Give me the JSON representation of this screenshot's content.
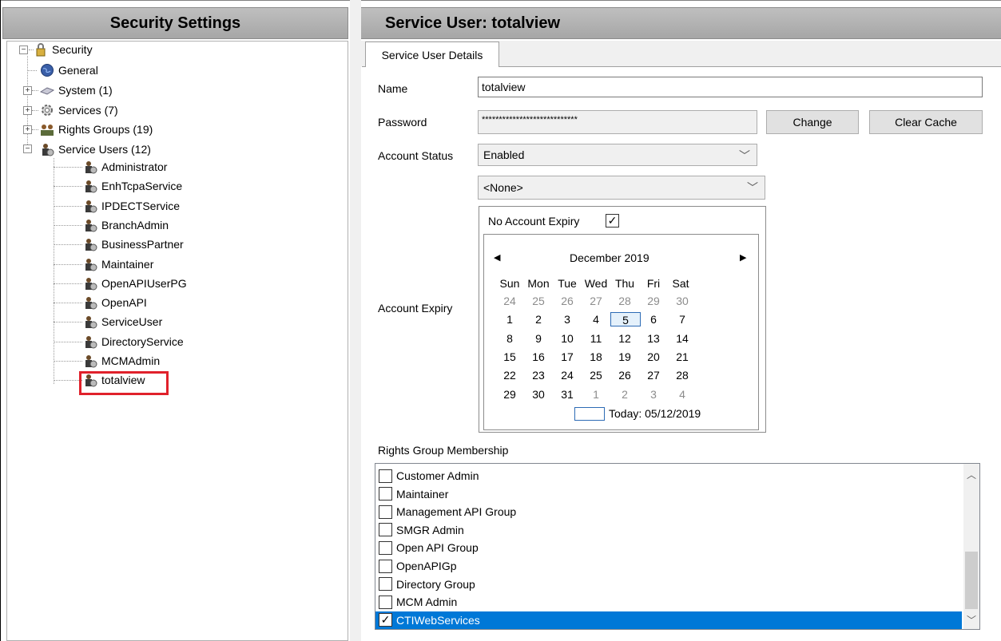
{
  "left": {
    "title": "Security Settings",
    "tree": {
      "root": "Security",
      "general": "General",
      "system": "System (1)",
      "services": "Services (7)",
      "rights_groups": "Rights Groups (19)",
      "service_users": "Service Users (12)",
      "users": [
        "Administrator",
        "EnhTcpaService",
        "IPDECTService",
        "BranchAdmin",
        "BusinessPartner",
        "Maintainer",
        "OpenAPIUserPG",
        "OpenAPI",
        "ServiceUser",
        "DirectoryService",
        "MCMAdmin",
        "totalview"
      ]
    }
  },
  "right": {
    "title": "Service User:  totalview",
    "tab_label": "Service User Details",
    "name_label": "Name",
    "name_value": "totalview",
    "password_label": "Password",
    "password_value": "****************************",
    "change_button": "Change",
    "clear_cache_button": "Clear Cache",
    "account_status_label": "Account Status",
    "account_status_value": "Enabled",
    "second_combo_value": "<None>",
    "account_expiry_label": "Account Expiry",
    "no_expiry_label": "No Account Expiry",
    "no_expiry_checked": true,
    "calendar": {
      "month_label": "December 2019",
      "prev": "◀",
      "next": "▶",
      "weekdays": [
        "Sun",
        "Mon",
        "Tue",
        "Wed",
        "Thu",
        "Fri",
        "Sat"
      ],
      "weeks": [
        [
          "24",
          "25",
          "26",
          "27",
          "28",
          "29",
          "30"
        ],
        [
          "1",
          "2",
          "3",
          "4",
          "5",
          "6",
          "7"
        ],
        [
          "8",
          "9",
          "10",
          "11",
          "12",
          "13",
          "14"
        ],
        [
          "15",
          "16",
          "17",
          "18",
          "19",
          "20",
          "21"
        ],
        [
          "22",
          "23",
          "24",
          "25",
          "26",
          "27",
          "28"
        ],
        [
          "29",
          "30",
          "31",
          "1",
          "2",
          "3",
          "4"
        ]
      ],
      "selected_day": "5",
      "today_label": "Today: 05/12/2019"
    },
    "rights_group_label": "Rights Group Membership",
    "rights_groups": [
      {
        "label": "Customer Admin",
        "checked": false
      },
      {
        "label": "Maintainer",
        "checked": false
      },
      {
        "label": "Management API Group",
        "checked": false
      },
      {
        "label": "SMGR Admin",
        "checked": false
      },
      {
        "label": "Open API Group",
        "checked": false
      },
      {
        "label": "OpenAPIGp",
        "checked": false
      },
      {
        "label": "Directory Group",
        "checked": false
      },
      {
        "label": "MCM Admin",
        "checked": false
      },
      {
        "label": "CTIWebServices",
        "checked": true,
        "selected": true
      }
    ]
  },
  "colors": {
    "header_bg": "#b3b3b3",
    "selection": "#0078d7",
    "highlight_border": "#e0212b"
  }
}
